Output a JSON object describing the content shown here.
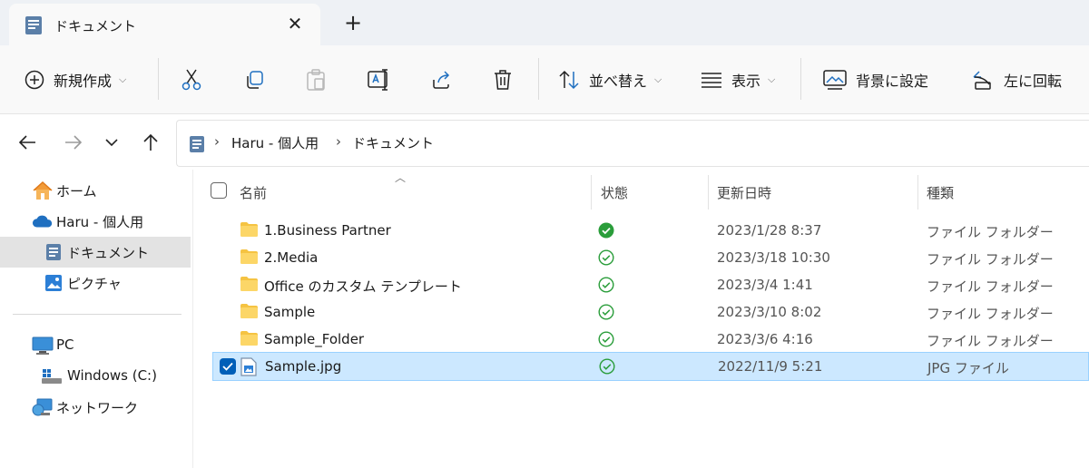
{
  "tab": {
    "title": "ドキュメント",
    "close": "✕"
  },
  "new_tab": "+",
  "toolbar": {
    "new_label": "新規作成",
    "sort_label": "並べ替え",
    "view_label": "表示",
    "wallpaper_label": "背景に設定",
    "rotate_label": "左に回転"
  },
  "breadcrumb": [
    "Haru - 個人用",
    "ドキュメント"
  ],
  "breadcrumb_sep": "›",
  "sidebar": {
    "items": [
      {
        "label": "ホーム",
        "icon": "home-icon"
      },
      {
        "label": "Haru - 個人用",
        "icon": "onedrive-cloud-icon"
      },
      {
        "label": "ドキュメント",
        "icon": "documents-icon",
        "selected": true
      },
      {
        "label": "ピクチャ",
        "icon": "pictures-icon"
      },
      {
        "label": "PC",
        "icon": "pc-icon"
      },
      {
        "label": "Windows  (C:)",
        "icon": "drive-icon"
      },
      {
        "label": "ネットワーク",
        "icon": "network-icon"
      }
    ]
  },
  "columns": {
    "name": "名前",
    "status": "状態",
    "date": "更新日時",
    "type": "種類"
  },
  "files": [
    {
      "name": "1.Business Partner",
      "date": "2023/1/28 8:37",
      "type": "ファイル フォルダー",
      "kind": "folder",
      "status": "always-available"
    },
    {
      "name": "2.Media",
      "date": "2023/3/18 10:30",
      "type": "ファイル フォルダー",
      "kind": "folder",
      "status": "available"
    },
    {
      "name": "Office のカスタム テンプレート",
      "date": "2023/3/4 1:41",
      "type": "ファイル フォルダー",
      "kind": "folder",
      "status": "available"
    },
    {
      "name": "Sample",
      "date": "2023/3/10 8:02",
      "type": "ファイル フォルダー",
      "kind": "folder",
      "status": "available"
    },
    {
      "name": "Sample_Folder",
      "date": "2023/3/6 4:16",
      "type": "ファイル フォルダー",
      "kind": "folder",
      "status": "available"
    },
    {
      "name": "Sample.jpg",
      "date": "2022/11/9 5:21",
      "type": "JPG ファイル",
      "kind": "image",
      "status": "available",
      "selected": true
    }
  ],
  "colors": {
    "accent": "#005fb8",
    "selection": "#cce8ff",
    "sync_green": "#2a9d3a",
    "folder": "#f5c342"
  }
}
